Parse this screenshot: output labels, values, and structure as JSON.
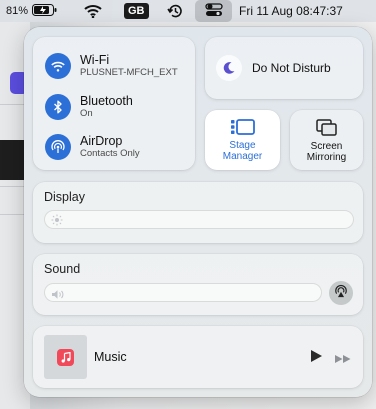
{
  "menubar": {
    "battery_percent": "81%",
    "input_source": "GB",
    "datetime": "Fri 11 Aug  08:47:37"
  },
  "network": {
    "wifi": {
      "title": "Wi-Fi",
      "subtitle": "PLUSNET-MFCH_EXT"
    },
    "bluetooth": {
      "title": "Bluetooth",
      "subtitle": "On"
    },
    "airdrop": {
      "title": "AirDrop",
      "subtitle": "Contacts Only"
    }
  },
  "focus": {
    "label": "Do Not Disturb"
  },
  "stage_manager": {
    "line1": "Stage",
    "line2": "Manager"
  },
  "screen_mirroring": {
    "line1": "Screen",
    "line2": "Mirroring"
  },
  "display": {
    "title": "Display",
    "level": 0.0
  },
  "sound": {
    "title": "Sound",
    "level": 0.0
  },
  "now_playing": {
    "app": "Music"
  },
  "colors": {
    "accent": "#2c6fd7",
    "stage_manager_text": "#2c6fd7",
    "moon": "#5a4fcf"
  }
}
